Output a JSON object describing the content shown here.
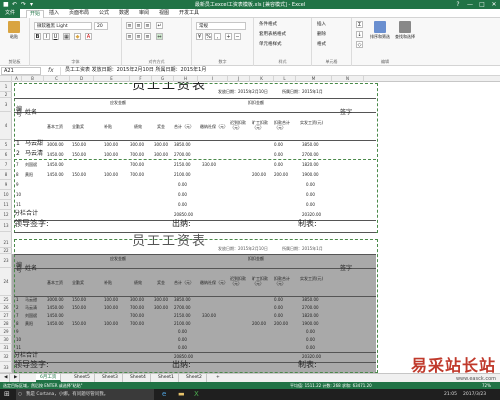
{
  "window": {
    "doc_title": "最新员工excel工资表模板.xls [兼容模式] - Excel",
    "help": "?",
    "min": "—",
    "max": "□",
    "close": "✕"
  },
  "ribbon_tabs": [
    "文件",
    "开始",
    "插入",
    "页面布局",
    "公式",
    "数据",
    "审阅",
    "视图",
    "开发工具"
  ],
  "ribbon": {
    "paste": "粘贴",
    "clipboard": "剪贴板",
    "font_name": "微软雅黑 Light",
    "font_size": "20",
    "font_group": "字体",
    "align_group": "对齐方式",
    "number_format": "常规",
    "number_group": "数字",
    "cond_format": "条件格式",
    "table_format": "套用表格格式",
    "cell_style": "单元格样式",
    "style_group": "样式",
    "insert": "插入",
    "delete": "删除",
    "format": "格式",
    "cells_group": "单元格",
    "sort_filter": "排序和筛选",
    "find_select": "查找和选择",
    "edit_group": "编辑"
  },
  "formula_bar": {
    "name_box": "A21",
    "fx": "fx",
    "content": "员工工资表   发放日期：2015年2月10日  所属日期：2015年1月"
  },
  "columns": [
    "A",
    "B",
    "C",
    "D",
    "E",
    "F",
    "G",
    "H",
    "I",
    "J",
    "K",
    "L",
    "M",
    "N"
  ],
  "rows_top": [
    "1",
    "2",
    "3",
    "4",
    "5",
    "6",
    "7",
    "8",
    "9",
    "10",
    "11",
    "12",
    "13"
  ],
  "rows_bottom": [
    "21",
    "22",
    "23",
    "24",
    "25",
    "26",
    "27",
    "28",
    "29",
    "30",
    "31",
    "32",
    "33",
    "34",
    "35",
    "36",
    "37",
    "38"
  ],
  "table1": {
    "title": "员工工资表",
    "issue_date": "发放日期：2015年2月10日",
    "period": "所属日期：2015年1月",
    "col_no": "编号",
    "col_name": "姓名",
    "group_payable": "应发金额",
    "group_deduct": "扣扣金额",
    "sub_base": "基本工资",
    "sub_full": "全勤奖",
    "sub_bonus": "补贴",
    "sub_perf": "绩效",
    "sub_reward": "奖金",
    "sub_total": "合计（元）",
    "sub_social": "缴纳社保（元）",
    "sub_leave": "迟到扣款（元）",
    "sub_absent": "旷工扣款（元）",
    "sub_deduct_total": "扣款合计（元）",
    "col_net": "实发工资(元)",
    "col_sign": "签字",
    "rows": [
      {
        "no": "1",
        "name": "马云甜",
        "base": "3000.00",
        "full": "150.00",
        "bonus": "100.00",
        "perf": "300.00",
        "reward": "300.00",
        "total": "3850.00",
        "social": "",
        "leave": "",
        "absent": "",
        "dtotal": "0.00",
        "net": "3850.00"
      },
      {
        "no": "2",
        "name": "马云清",
        "base": "1450.00",
        "full": "150.00",
        "bonus": "100.00",
        "perf": "700.00",
        "reward": "300.00",
        "total": "2700.00",
        "social": "",
        "leave": "",
        "absent": "",
        "dtotal": "0.00",
        "net": "2700.00"
      },
      {
        "no": "7",
        "name": "刘国斌",
        "base": "1450.00",
        "full": "",
        "bonus": "",
        "perf": "700.00",
        "reward": "",
        "total": "2150.00",
        "social": "330.00",
        "leave": "",
        "absent": "",
        "dtotal": "0.00",
        "net": "1820.00"
      },
      {
        "no": "8",
        "name": "黄阳",
        "base": "1450.00",
        "full": "150.00",
        "bonus": "100.00",
        "perf": "700.00",
        "reward": "",
        "total": "2100.00",
        "social": "",
        "leave": "",
        "absent": "200.00",
        "dtotal": "200.00",
        "net": "1900.00"
      },
      {
        "no": "9",
        "name": "",
        "base": "",
        "full": "",
        "bonus": "",
        "perf": "",
        "reward": "",
        "total": "0.00",
        "social": "",
        "leave": "",
        "absent": "",
        "dtotal": "",
        "net": "0.00"
      },
      {
        "no": "10",
        "name": "",
        "base": "",
        "full": "",
        "bonus": "",
        "perf": "",
        "reward": "",
        "total": "0.00",
        "social": "",
        "leave": "",
        "absent": "",
        "dtotal": "",
        "net": "0.00"
      },
      {
        "no": "11",
        "name": "",
        "base": "",
        "full": "",
        "bonus": "",
        "perf": "",
        "reward": "",
        "total": "0.00",
        "social": "",
        "leave": "",
        "absent": "",
        "dtotal": "",
        "net": "0.00"
      }
    ],
    "subtotal_label": "分栏合计",
    "subtotal_value": "20850.00",
    "subtotal_net": "20320.00",
    "leader_sign": "领导签字:",
    "cashier": "出纳:",
    "maker": "制表:"
  },
  "table2": {
    "title": "员工工资表",
    "issue_date": "发放日期：2015年2月10日",
    "period": "所属日期：2015年1月",
    "col_no": "编号",
    "col_name": "姓名",
    "group_payable": "应发金额",
    "group_deduct": "扣扣金额",
    "sub_base": "基本工资",
    "sub_full": "全勤奖",
    "sub_bonus": "补贴",
    "sub_perf": "绩效",
    "sub_reward": "奖金",
    "sub_total": "合计（元）",
    "sub_social": "缴纳社保（元）",
    "sub_leave": "迟到扣款（元）",
    "sub_absent": "旷工扣款（元）",
    "sub_deduct_total": "扣款合计（元）",
    "col_net": "实发工资(元)",
    "col_sign": "签字",
    "rows": [
      {
        "no": "1",
        "name": "马云甜",
        "base": "3000.00",
        "full": "150.00",
        "bonus": "100.00",
        "perf": "300.00",
        "reward": "300.00",
        "total": "3850.00",
        "social": "",
        "leave": "",
        "absent": "",
        "dtotal": "0.00",
        "net": "3850.00"
      },
      {
        "no": "2",
        "name": "马云清",
        "base": "1450.00",
        "full": "150.00",
        "bonus": "100.00",
        "perf": "700.00",
        "reward": "300.00",
        "total": "2700.00",
        "social": "",
        "leave": "",
        "absent": "",
        "dtotal": "0.00",
        "net": "2700.00"
      },
      {
        "no": "7",
        "name": "刘国斌",
        "base": "1450.00",
        "full": "",
        "bonus": "",
        "perf": "700.00",
        "reward": "",
        "total": "2150.00",
        "social": "330.00",
        "leave": "",
        "absent": "",
        "dtotal": "0.00",
        "net": "1820.00"
      },
      {
        "no": "8",
        "name": "黄阳",
        "base": "1450.00",
        "full": "150.00",
        "bonus": "100.00",
        "perf": "700.00",
        "reward": "",
        "total": "2100.00",
        "social": "",
        "leave": "",
        "absent": "200.00",
        "dtotal": "200.00",
        "net": "1900.00"
      },
      {
        "no": "9",
        "name": "",
        "base": "",
        "full": "",
        "bonus": "",
        "perf": "",
        "reward": "",
        "total": "0.00",
        "social": "",
        "leave": "",
        "absent": "",
        "dtotal": "",
        "net": "0.00"
      },
      {
        "no": "10",
        "name": "",
        "base": "",
        "full": "",
        "bonus": "",
        "perf": "",
        "reward": "",
        "total": "0.00",
        "social": "",
        "leave": "",
        "absent": "",
        "dtotal": "",
        "net": "0.00"
      },
      {
        "no": "11",
        "name": "",
        "base": "",
        "full": "",
        "bonus": "",
        "perf": "",
        "reward": "",
        "total": "0.00",
        "social": "",
        "leave": "",
        "absent": "",
        "dtotal": "",
        "net": "0.00"
      }
    ],
    "subtotal_label": "分栏合计",
    "subtotal_value": "20850.00",
    "subtotal_net": "20320.00",
    "leader_sign": "领导签字:",
    "cashier": "出纳:",
    "maker": "制表:"
  },
  "sheet_tabs": [
    "6月工资",
    "Sheet5",
    "Sheet3",
    "Sheet4",
    "Sheet1",
    "Sheet2"
  ],
  "add_sheet": "+",
  "status": {
    "left": "选定目标区域，然后按 ENTER 或选择\"粘贴\"",
    "sum": "平均值: 1511.22  计数: 268  求和: 63471.20",
    "zoom": "72%"
  },
  "taskbar": {
    "search": "我是 Cortana，小娜。有问题尽管问我。",
    "time": "21:05",
    "date": "2017/3/23"
  },
  "watermark": {
    "text": "易采站长站",
    "url": "www.easck.com"
  }
}
